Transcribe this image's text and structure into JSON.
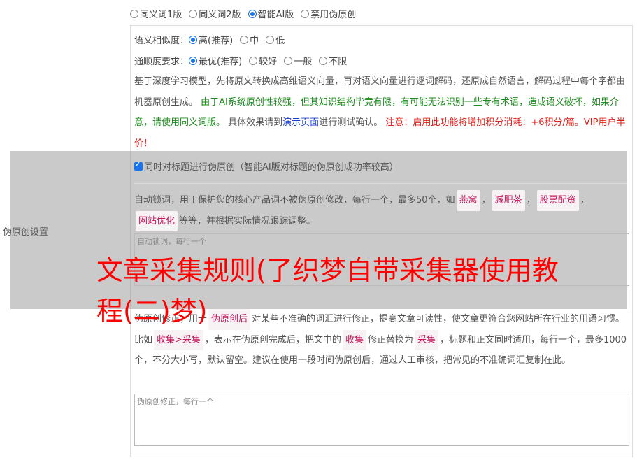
{
  "mode_options": [
    {
      "label": "同义词1版",
      "selected": false
    },
    {
      "label": "同义词2版",
      "selected": false
    },
    {
      "label": "智能AI版",
      "selected": true
    },
    {
      "label": "禁用伪原创",
      "selected": false
    }
  ],
  "similarity": {
    "label": "语义相似度：",
    "options": [
      {
        "label": "高(推荐)",
        "selected": true
      },
      {
        "label": "中",
        "selected": false
      },
      {
        "label": "低",
        "selected": false
      }
    ]
  },
  "fluency": {
    "label": "通顺度要求：",
    "options": [
      {
        "label": "最优(推荐)",
        "selected": true
      },
      {
        "label": "较好",
        "selected": false
      },
      {
        "label": "一般",
        "selected": false
      },
      {
        "label": "不限",
        "selected": false
      }
    ]
  },
  "description": {
    "p1": "基于深度学习模型，先将原文转换成高维语义向量，再对语义向量进行逐词解码，还原成自然语言，解码过程中每个字都由机器原创生成。",
    "p2_green": "由于AI系统原创性较强，但其知识结构毕竟有限，有可能无法识别一些专有术语，造成语义破坏，如果介意，请使用同义词版。",
    "p3": "具体效果请到",
    "p3_link": "演示页面",
    "p3_end": "进行测试确认。",
    "p4_red": "注意：启用此功能将增加积分消耗：+6积分/篇。VIP用户半价！"
  },
  "section_label": "伪原创设置",
  "title_checkbox": "同时对标题进行伪原创（智能AI版对标题的伪原创成功率较高）",
  "lock_words": {
    "desc_start": "自动锁词，用于保护您的核心产品词不被伪原创修改，每行一个，最多50个，如",
    "tags": [
      "燕窝",
      "减肥茶",
      "股票配资",
      "网站优化"
    ],
    "desc_end": "等等，并根据实际情况跟踪调整。",
    "placeholder": "自动锁词，每行一个"
  },
  "corrections": {
    "t1": "伪原创修正，用于",
    "tag1": "伪原创后",
    "t2": "对某些不准确的词汇进行修正，提高文章可读性，使文章更符合您网站所在行业的用语习惯。比如",
    "tag2": "收集>采集",
    "t3": "，表示在伪原创完成后，把文中的",
    "tag3": "收集",
    "t4": "修正替换为",
    "tag4": "采集",
    "t5": "，标题和正文同时适用，每行一个，最多1000个，不分大小写，默认留空。建议在使用一段时间伪原创后，通过人工审核，把常见的不准确词汇复制在此。",
    "placeholder": "伪原创修正，每行一个"
  },
  "watermark_text": "文章采集规则(了织梦自带采集器使用教程(二)梦)"
}
